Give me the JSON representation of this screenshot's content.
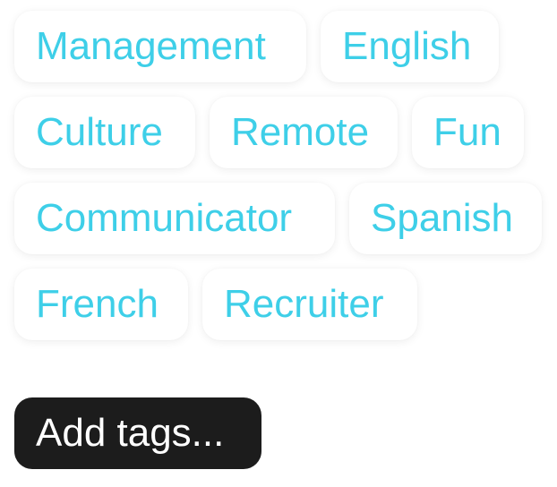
{
  "tags": [
    "Management",
    "English",
    "Culture",
    "Remote",
    "Fun",
    "Communicator",
    "Spanish",
    "French",
    "Recruiter"
  ],
  "add_button": {
    "label": "Add tags..."
  },
  "colors": {
    "tag_text": "#3ecfe8",
    "tag_background": "#ffffff",
    "button_background": "#1c1c1c",
    "button_text": "#ffffff"
  }
}
